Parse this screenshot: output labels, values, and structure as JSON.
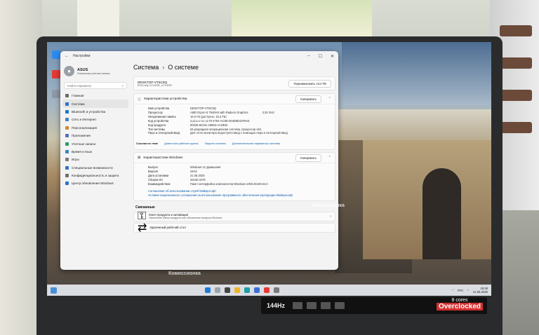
{
  "settings_window": {
    "app_title": "Настройки",
    "user": {
      "name": "ASUS",
      "subtitle": "Локальная учетная запись"
    },
    "search_placeholder": "Найти параметр",
    "nav": [
      {
        "label": "Главная",
        "color": "#6b6b6b"
      },
      {
        "label": "Система",
        "color": "#2b74c7"
      },
      {
        "label": "Bluetooth и устройства",
        "color": "#1a78c2"
      },
      {
        "label": "Сеть и Интернет",
        "color": "#4a7fbf"
      },
      {
        "label": "Персонализация",
        "color": "#d08a2c"
      },
      {
        "label": "Приложения",
        "color": "#5c6bc0"
      },
      {
        "label": "Учетные записи",
        "color": "#2e9a6c"
      },
      {
        "label": "Время и язык",
        "color": "#3b83c4"
      },
      {
        "label": "Игры",
        "color": "#7a7a7a"
      },
      {
        "label": "Специальные возможности",
        "color": "#2b74c7"
      },
      {
        "label": "Конфиденциальность и защита",
        "color": "#6d6d6d"
      },
      {
        "label": "Центр обновления Windows",
        "color": "#2b74c7"
      }
    ],
    "breadcrumb": {
      "parent": "Система",
      "separator": "›",
      "current": "О системе"
    },
    "device_card": {
      "name": "DESKTOP-VT6C9Q",
      "model": "ROG Ally G710GR_G710GR",
      "rename_button": "Переименовать этот ПК"
    },
    "device_specs": {
      "title": "Характеристики устройства",
      "copy_button": "Копировать",
      "rows": [
        {
          "k": "Имя устройства",
          "v": "DESKTOP-VT6C9Q"
        },
        {
          "k": "Процессор",
          "v": "AMD Ryzen 9 7940HS with Radeon Graphics",
          "v2": "3.30 GHz"
        },
        {
          "k": "Оперативная память",
          "v": "16,0 ГБ (доступно: 15,3 ГБ)"
        },
        {
          "k": "Код устройства",
          "v": "B4D5AF92-3E70-4754-AC8D-304D8D42F9A6"
        },
        {
          "k": "Код продукта",
          "v": "00325-82191-18983-AAOEM"
        },
        {
          "k": "Тип системы",
          "v": "64-разрядная операционная система, процессор x64"
        },
        {
          "k": "Перо и сенсорный ввод",
          "v": "Для этого монитора недоступен ввод с помощью пера и сенсорный ввод"
        }
      ]
    },
    "related_links": {
      "label": "Ссылки по теме",
      "items": [
        "Домен или рабочая группа",
        "Защита системы",
        "Дополнительные параметры системы"
      ]
    },
    "windows_specs": {
      "title": "Характеристики Windows",
      "copy_button": "Копировать",
      "rows": [
        {
          "k": "Выпуск",
          "v": "Windows 11 Домашняя"
        },
        {
          "k": "Версия",
          "v": "24H2"
        },
        {
          "k": "Дата установки",
          "v": "21.05.2025"
        },
        {
          "k": "Сборка ОС",
          "v": "26100.3476"
        },
        {
          "k": "Взаимодействие",
          "v": "Пакет интерфейса компонентов Windows 1000.26100.54.0"
        }
      ],
      "links": [
        "Соглашение об использовании служб Майкрософт",
        "Условия лицензионного соглашения на использование программного обеспечения корпорации Майкрософт"
      ]
    },
    "related": {
      "label": "Связанные",
      "items": [
        {
          "title": "Ключ продукта и активация",
          "subtitle": "Изменение ключа продукта или обновление выпуска Windows"
        },
        {
          "title": "Удаленный рабочий стол",
          "subtitle": ""
        }
      ]
    }
  },
  "taskbar": {
    "language": "РУС",
    "time": "18:48",
    "date": "21.05.2025"
  },
  "stickers": {
    "refresh_rate": "144Hz",
    "cores_label": "8 cores",
    "cores_badge": "Overclocked"
  },
  "watermark": {
    "text": "Комиссионка"
  }
}
